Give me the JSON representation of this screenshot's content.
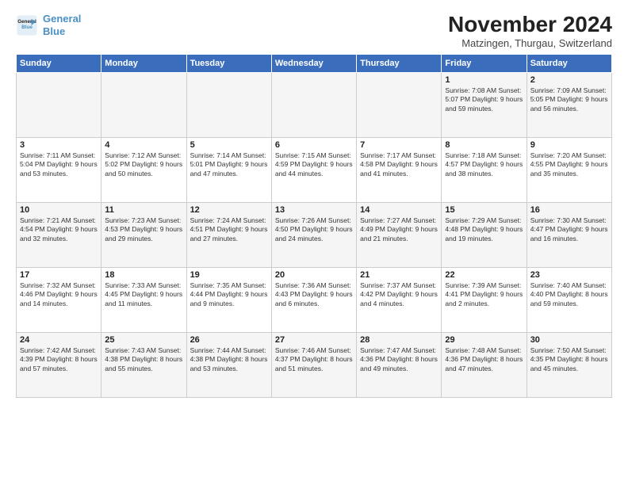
{
  "logo": {
    "line1": "General",
    "line2": "Blue",
    "icon_color": "#4a90c4"
  },
  "title": "November 2024",
  "subtitle": "Matzingen, Thurgau, Switzerland",
  "days_of_week": [
    "Sunday",
    "Monday",
    "Tuesday",
    "Wednesday",
    "Thursday",
    "Friday",
    "Saturday"
  ],
  "weeks": [
    [
      {
        "day": "",
        "detail": ""
      },
      {
        "day": "",
        "detail": ""
      },
      {
        "day": "",
        "detail": ""
      },
      {
        "day": "",
        "detail": ""
      },
      {
        "day": "",
        "detail": ""
      },
      {
        "day": "1",
        "detail": "Sunrise: 7:08 AM\nSunset: 5:07 PM\nDaylight: 9 hours and 59 minutes."
      },
      {
        "day": "2",
        "detail": "Sunrise: 7:09 AM\nSunset: 5:05 PM\nDaylight: 9 hours and 56 minutes."
      }
    ],
    [
      {
        "day": "3",
        "detail": "Sunrise: 7:11 AM\nSunset: 5:04 PM\nDaylight: 9 hours and 53 minutes."
      },
      {
        "day": "4",
        "detail": "Sunrise: 7:12 AM\nSunset: 5:02 PM\nDaylight: 9 hours and 50 minutes."
      },
      {
        "day": "5",
        "detail": "Sunrise: 7:14 AM\nSunset: 5:01 PM\nDaylight: 9 hours and 47 minutes."
      },
      {
        "day": "6",
        "detail": "Sunrise: 7:15 AM\nSunset: 4:59 PM\nDaylight: 9 hours and 44 minutes."
      },
      {
        "day": "7",
        "detail": "Sunrise: 7:17 AM\nSunset: 4:58 PM\nDaylight: 9 hours and 41 minutes."
      },
      {
        "day": "8",
        "detail": "Sunrise: 7:18 AM\nSunset: 4:57 PM\nDaylight: 9 hours and 38 minutes."
      },
      {
        "day": "9",
        "detail": "Sunrise: 7:20 AM\nSunset: 4:55 PM\nDaylight: 9 hours and 35 minutes."
      }
    ],
    [
      {
        "day": "10",
        "detail": "Sunrise: 7:21 AM\nSunset: 4:54 PM\nDaylight: 9 hours and 32 minutes."
      },
      {
        "day": "11",
        "detail": "Sunrise: 7:23 AM\nSunset: 4:53 PM\nDaylight: 9 hours and 29 minutes."
      },
      {
        "day": "12",
        "detail": "Sunrise: 7:24 AM\nSunset: 4:51 PM\nDaylight: 9 hours and 27 minutes."
      },
      {
        "day": "13",
        "detail": "Sunrise: 7:26 AM\nSunset: 4:50 PM\nDaylight: 9 hours and 24 minutes."
      },
      {
        "day": "14",
        "detail": "Sunrise: 7:27 AM\nSunset: 4:49 PM\nDaylight: 9 hours and 21 minutes."
      },
      {
        "day": "15",
        "detail": "Sunrise: 7:29 AM\nSunset: 4:48 PM\nDaylight: 9 hours and 19 minutes."
      },
      {
        "day": "16",
        "detail": "Sunrise: 7:30 AM\nSunset: 4:47 PM\nDaylight: 9 hours and 16 minutes."
      }
    ],
    [
      {
        "day": "17",
        "detail": "Sunrise: 7:32 AM\nSunset: 4:46 PM\nDaylight: 9 hours and 14 minutes."
      },
      {
        "day": "18",
        "detail": "Sunrise: 7:33 AM\nSunset: 4:45 PM\nDaylight: 9 hours and 11 minutes."
      },
      {
        "day": "19",
        "detail": "Sunrise: 7:35 AM\nSunset: 4:44 PM\nDaylight: 9 hours and 9 minutes."
      },
      {
        "day": "20",
        "detail": "Sunrise: 7:36 AM\nSunset: 4:43 PM\nDaylight: 9 hours and 6 minutes."
      },
      {
        "day": "21",
        "detail": "Sunrise: 7:37 AM\nSunset: 4:42 PM\nDaylight: 9 hours and 4 minutes."
      },
      {
        "day": "22",
        "detail": "Sunrise: 7:39 AM\nSunset: 4:41 PM\nDaylight: 9 hours and 2 minutes."
      },
      {
        "day": "23",
        "detail": "Sunrise: 7:40 AM\nSunset: 4:40 PM\nDaylight: 8 hours and 59 minutes."
      }
    ],
    [
      {
        "day": "24",
        "detail": "Sunrise: 7:42 AM\nSunset: 4:39 PM\nDaylight: 8 hours and 57 minutes."
      },
      {
        "day": "25",
        "detail": "Sunrise: 7:43 AM\nSunset: 4:38 PM\nDaylight: 8 hours and 55 minutes."
      },
      {
        "day": "26",
        "detail": "Sunrise: 7:44 AM\nSunset: 4:38 PM\nDaylight: 8 hours and 53 minutes."
      },
      {
        "day": "27",
        "detail": "Sunrise: 7:46 AM\nSunset: 4:37 PM\nDaylight: 8 hours and 51 minutes."
      },
      {
        "day": "28",
        "detail": "Sunrise: 7:47 AM\nSunset: 4:36 PM\nDaylight: 8 hours and 49 minutes."
      },
      {
        "day": "29",
        "detail": "Sunrise: 7:48 AM\nSunset: 4:36 PM\nDaylight: 8 hours and 47 minutes."
      },
      {
        "day": "30",
        "detail": "Sunrise: 7:50 AM\nSunset: 4:35 PM\nDaylight: 8 hours and 45 minutes."
      }
    ]
  ]
}
